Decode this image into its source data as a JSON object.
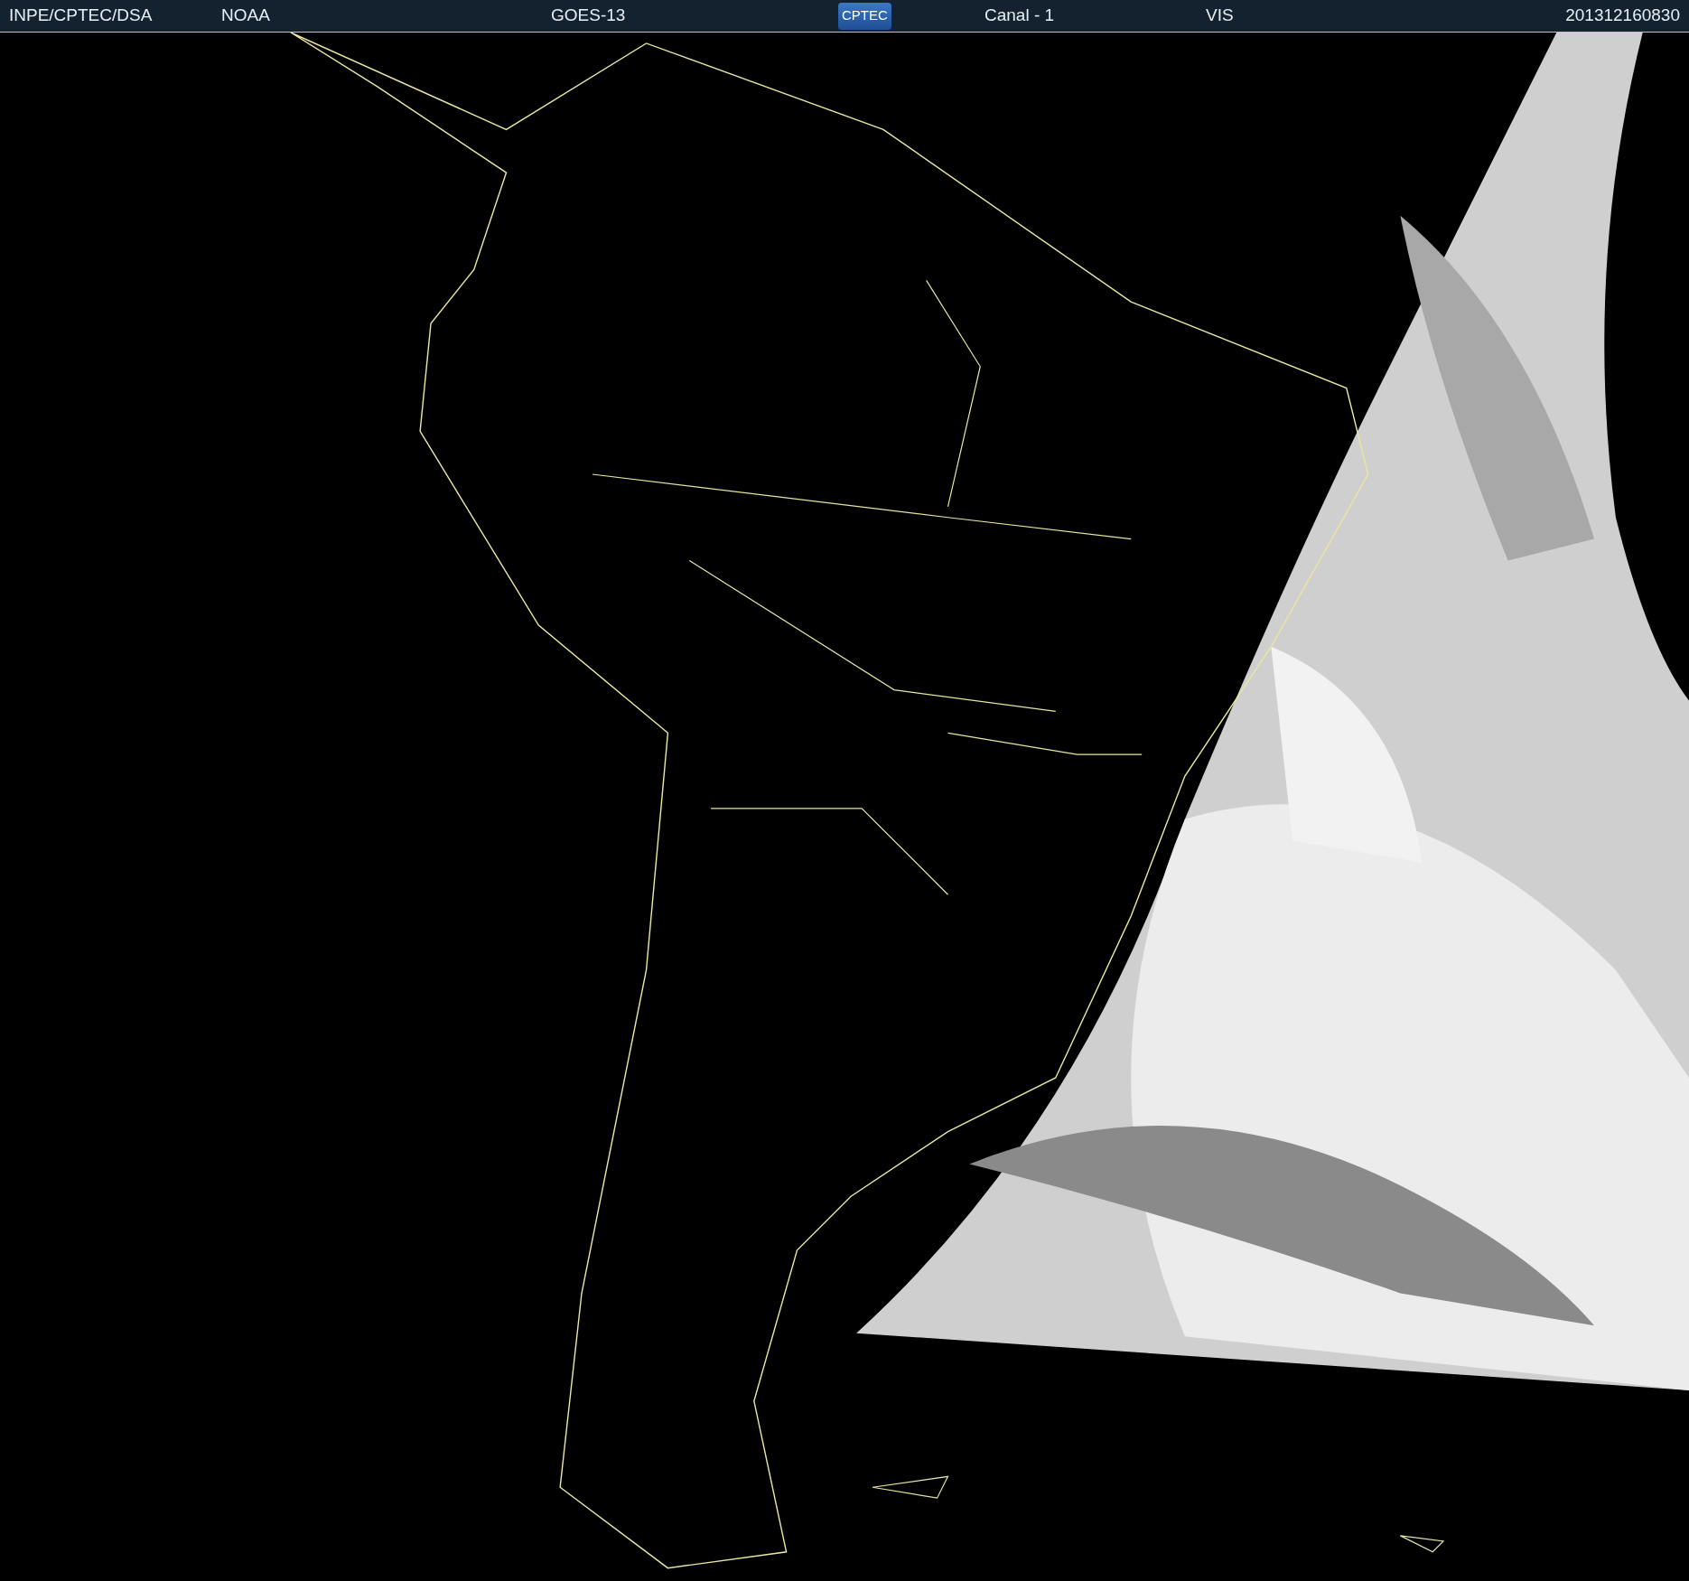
{
  "header": {
    "items": [
      {
        "kind": "text",
        "label": "INPE/CPTEC/DSA"
      },
      {
        "kind": "text",
        "label": "NOAA"
      },
      {
        "kind": "text",
        "label": "GOES-13"
      },
      {
        "kind": "logo",
        "label": "CPTEC"
      },
      {
        "kind": "text",
        "label": "Canal - 1"
      },
      {
        "kind": "text",
        "label": "VIS"
      },
      {
        "kind": "text",
        "label": "201312160830"
      }
    ]
  }
}
